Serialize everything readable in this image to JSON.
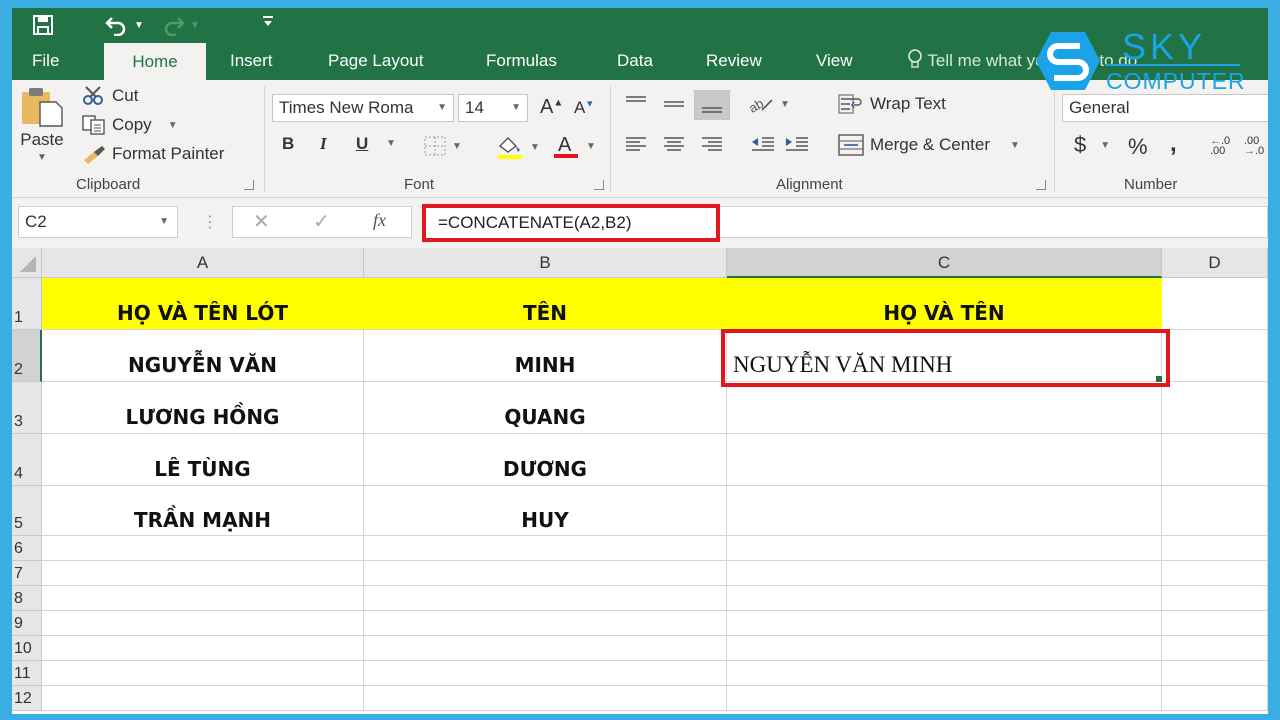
{
  "quick_access": {
    "save_icon": "save-icon",
    "undo_icon": "undo-icon",
    "redo_icon": "redo-icon",
    "customize_icon": "customize-qat-icon"
  },
  "tabs": [
    {
      "label": "File",
      "active": false
    },
    {
      "label": "Home",
      "active": true
    },
    {
      "label": "Insert",
      "active": false
    },
    {
      "label": "Page Layout",
      "active": false
    },
    {
      "label": "Formulas",
      "active": false
    },
    {
      "label": "Data",
      "active": false
    },
    {
      "label": "Review",
      "active": false
    },
    {
      "label": "View",
      "active": false
    }
  ],
  "tell_me": "Tell me what you want to do...",
  "watermark": {
    "line1": "SKY",
    "line2": "COMPUTER",
    "color": "#1aa3e8"
  },
  "ribbon": {
    "clipboard": {
      "paste": "Paste",
      "cut": "Cut",
      "copy": "Copy",
      "format_painter": "Format Painter",
      "label": "Clipboard"
    },
    "font": {
      "font_name": "Times New Roma",
      "font_size": "14",
      "bold": "B",
      "italic": "I",
      "underline": "U",
      "label": "Font",
      "fill_color": "#ffff00",
      "font_color": "#e0171f"
    },
    "alignment": {
      "wrap_text": "Wrap Text",
      "merge_center": "Merge & Center",
      "label": "Alignment"
    },
    "number": {
      "format": "General",
      "currency": "$",
      "percent": "%",
      "comma": ",",
      "label": "Number"
    }
  },
  "formula_bar": {
    "name_box": "C2",
    "formula": "=CONCATENATE(A2,B2)",
    "fx": "fx"
  },
  "sheet": {
    "columns": [
      "A",
      "B",
      "C",
      "D"
    ],
    "selected_column": "C",
    "selected_row": "2",
    "rows": [
      "1",
      "2",
      "3",
      "4",
      "5",
      "6",
      "7",
      "8",
      "9",
      "10",
      "11",
      "12"
    ],
    "header_row": [
      "HỌ VÀ TÊN LÓT",
      "TÊN",
      "HỌ VÀ TÊN"
    ],
    "data": [
      {
        "a": "NGUYỄN VĂN",
        "b": "MINH",
        "c": "NGUYỄN VĂN MINH"
      },
      {
        "a": "LƯƠNG HỒNG",
        "b": "QUANG",
        "c": ""
      },
      {
        "a": "LÊ TÙNG",
        "b": "DƯƠNG",
        "c": ""
      },
      {
        "a": "TRẦN MẠNH",
        "b": "HUY",
        "c": ""
      }
    ],
    "header_fill": "#ffff00",
    "highlight_color": "#e0171f"
  }
}
